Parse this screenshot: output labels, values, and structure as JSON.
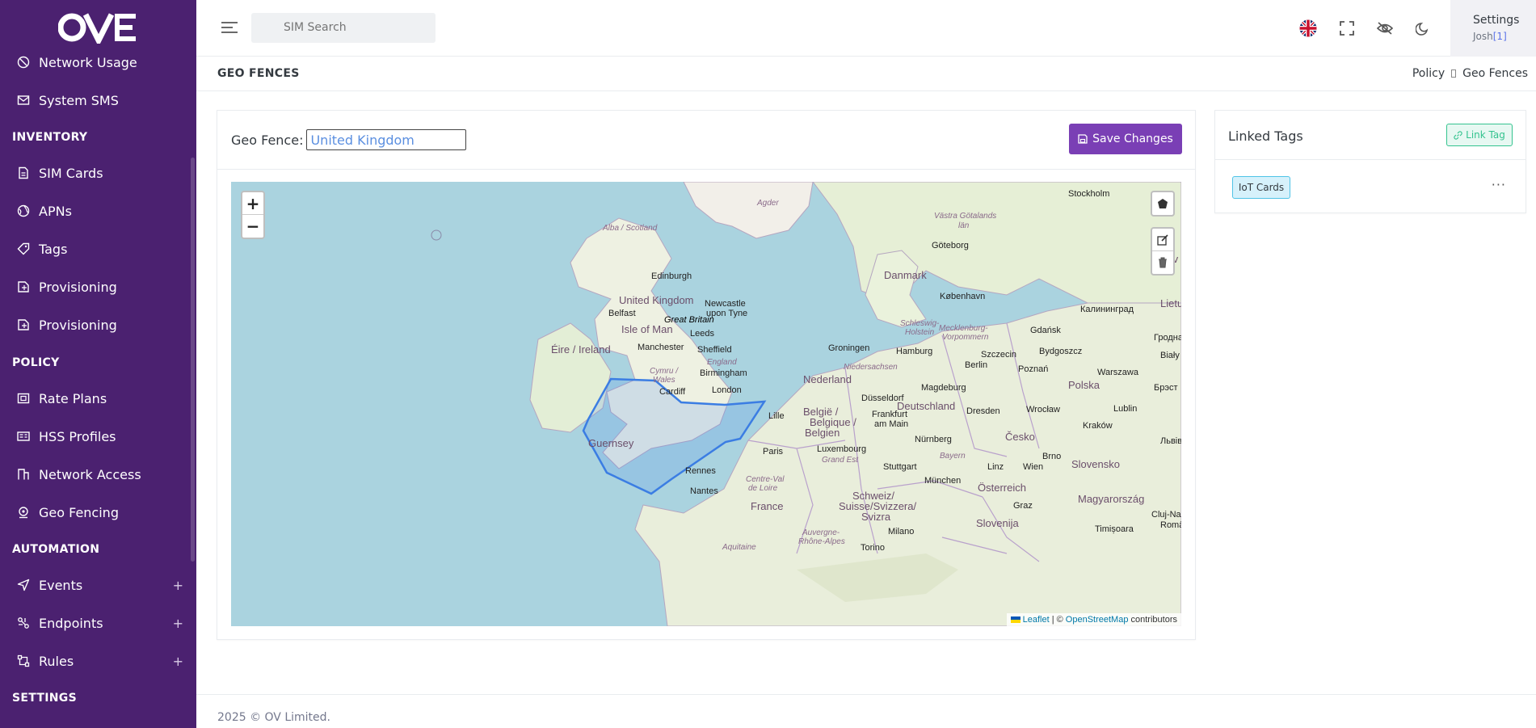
{
  "brand": {
    "logo": "OVE"
  },
  "sidebar": {
    "items": [
      {
        "label": "Network Usage",
        "icon": "network-usage-icon"
      },
      {
        "label": "System SMS",
        "icon": "sms-icon"
      },
      {
        "label": "SIM Cards",
        "icon": "sim-card-icon"
      },
      {
        "label": "APNs",
        "icon": "globe-icon"
      },
      {
        "label": "Tags",
        "icon": "tag-icon"
      },
      {
        "label": "Provisioning",
        "icon": "provisioning-icon"
      },
      {
        "label": "Provisioning",
        "icon": "provisioning-icon"
      },
      {
        "label": "Rate Plans",
        "icon": "rate-plan-icon"
      },
      {
        "label": "HSS Profiles",
        "icon": "id-card-icon"
      },
      {
        "label": "Network Access",
        "icon": "building-icon"
      },
      {
        "label": "Geo Fencing",
        "icon": "location-icon"
      },
      {
        "label": "Events",
        "icon": "send-icon"
      },
      {
        "label": "Endpoints",
        "icon": "endpoint-icon"
      },
      {
        "label": "Rules",
        "icon": "rules-icon"
      }
    ],
    "headers": {
      "inventory": "INVENTORY",
      "policy": "POLICY",
      "automation": "AUTOMATION",
      "settings": "SETTINGS"
    }
  },
  "topbar": {
    "search_placeholder": "SIM Search",
    "settings_label": "Settings",
    "user": "Josh",
    "user_id": "[1]"
  },
  "page": {
    "title": "GEO FENCES",
    "breadcrumb": [
      "Policy",
      "Geo Fences"
    ]
  },
  "geofence": {
    "label": "Geo Fence:",
    "value": "United Kingdom",
    "save_label": "Save Changes"
  },
  "map": {
    "zoom_in": "+",
    "zoom_out": "−",
    "attrib_leaflet": "Leaflet",
    "attrib_sep": "| ©",
    "attrib_osm": "OpenStreetMap",
    "attrib_contrib": "contributors",
    "labels": {
      "agder": "Agder",
      "stockholm": "Stockholm",
      "vastra": "Västra Götalands",
      "lan": "län",
      "alba": "Alba / Scotland",
      "goteborg": "Göteborg",
      "edinburgh": "Edinburgh",
      "danmark": "Danmark",
      "uk": "United Kingdom",
      "newcastle1": "Newcastle",
      "newcastle2": "upon Tyne",
      "kobenhavn": "København",
      "belfast": "Belfast",
      "greatbritain": "Great Britain",
      "isleofman": "Isle of Man",
      "leeds": "Leeds",
      "schleswig1": "Schleswig-",
      "schleswig2": "Holstein",
      "mecklenburg1": "Mecklenburg-",
      "mecklenburg2": "Vorpommern",
      "kaliningrad": "Калининград",
      "manchester": "Manchester",
      "sheffield": "Sheffield",
      "eire": "Éire / Ireland",
      "groningen": "Groningen",
      "hamburg": "Hamburg",
      "szczecin": "Szczecin",
      "gdansk": "Gdańsk",
      "bydgoszcz": "Bydgoszcz",
      "grodno": "Гродна",
      "england": "England",
      "niedersachsen": "Niedersachsen",
      "berlin": "Berlin",
      "poznan": "Poznań",
      "warszawa": "Warszawa",
      "bialy": "Biały",
      "birmingham": "Birmingham",
      "cymru": "Cymru /",
      "wales": "Wales",
      "nederland": "Nederland",
      "polska": "Polska",
      "cardiff": "Cardiff",
      "london": "London",
      "magdeburg": "Magdeburg",
      "brest": "Брэст",
      "dusseldorf": "Düsseldorf",
      "deutschland": "Deutschland",
      "belgie1": "België /",
      "belgie2": "Belgique /",
      "belgie3": "Belgien",
      "lille": "Lille",
      "dresden": "Dresden",
      "wroclaw": "Wrocław",
      "lublin": "Lublin",
      "frankfurt1": "Frankfurt",
      "frankfurt2": "am Main",
      "krakow": "Kraków",
      "guernsey": "Guernsey",
      "cesko": "Česko",
      "luxembourg": "Luxembourg",
      "nurnberg": "Nürnberg",
      "lviv": "Львів",
      "paris": "Paris",
      "grandest": "Grand Est",
      "bayern": "Bayern",
      "brno": "Brno",
      "slovensko": "Slovensko",
      "rennes": "Rennes",
      "stuttgart": "Stuttgart",
      "linz": "Linz",
      "wien": "Wien",
      "centreval1": "Centre-Val",
      "centreval2": "de Loire",
      "munchen": "München",
      "osterreich": "Österreich",
      "nantes": "Nantes",
      "magyarorszag": "Magyarország",
      "france": "France",
      "schweiz1": "Schweiz/",
      "schweiz2": "Suisse/Svizzera/",
      "schweiz3": "Svizra",
      "graz": "Graz",
      "clujnap": "Cluj-Nap",
      "slovenija": "Slovenija",
      "milano": "Milano",
      "timisoara": "Timișoara",
      "auvergne1": "Auvergne-",
      "auvergne2": "Rhône-Alpes",
      "torino": "Torino",
      "aquitaine": "Aquitaine",
      "roma": "Româ",
      "lietu": "Lietu",
      "tv": "tv"
    }
  },
  "linked_tags": {
    "title": "Linked Tags",
    "link_label": "Link Tag",
    "tags": [
      "IoT Cards"
    ]
  },
  "footer": {
    "text": "2025 © OV Limited."
  },
  "colors": {
    "sidebar": "#4b2170",
    "accent": "#7a3fb5",
    "success": "#34c38f",
    "info": "#4fc3e6",
    "water": "#aad3df"
  }
}
